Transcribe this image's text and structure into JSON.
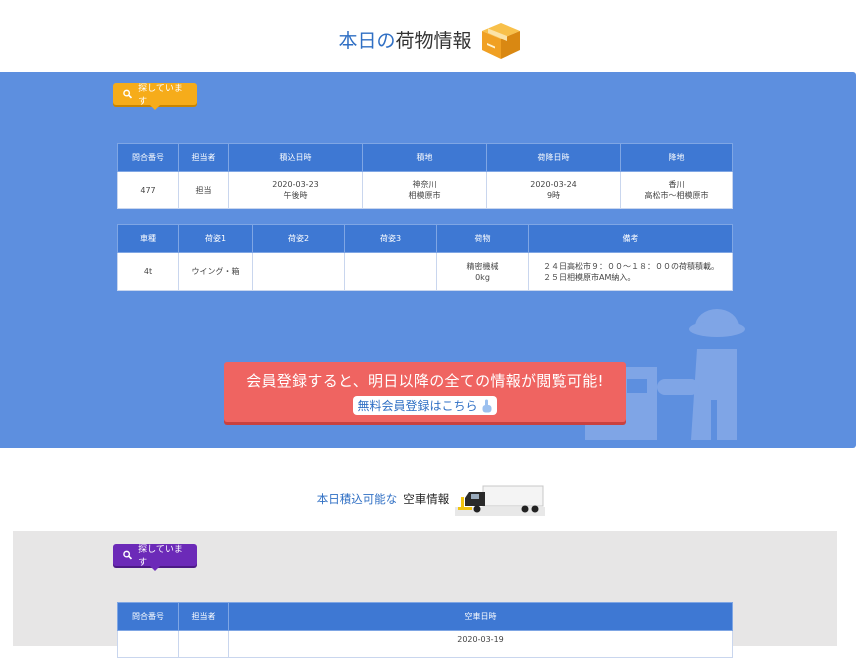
{
  "colors": {
    "accent_blue": "#5d8fdf",
    "header_blue": "#3e78d3",
    "cta_red": "#ef6461",
    "search_orange": "#f6ac1a",
    "search_purple": "#6c2ab8",
    "gray_panel": "#e7e6e6"
  },
  "cargo_section": {
    "title_part1": "本日の",
    "title_part2": "荷物情報",
    "box_icon": "cardboard-box-icon",
    "search_tab_label": "探しています",
    "table1": {
      "headers": [
        "問合番号",
        "担当者",
        "積込日時",
        "積地",
        "荷降日時",
        "降地"
      ],
      "row": {
        "inquiry_no": "477",
        "staff": "担当",
        "load_date": "2020-03-23",
        "load_time": "午後時",
        "load_place1": "神奈川",
        "load_place2": "相模原市",
        "unload_date": "2020-03-24",
        "unload_time": "9時",
        "unload_place1": "香川",
        "unload_place2": "高松市〜相模原市"
      }
    },
    "table2": {
      "headers": [
        "車種",
        "荷姿1",
        "荷姿2",
        "荷姿3",
        "荷物",
        "備考"
      ],
      "row": {
        "vehicle": "4t",
        "type1": "ウイング・箱",
        "type2": "",
        "type3": "",
        "cargo_name": "精密機械",
        "cargo_weight": "0kg",
        "note": "２４日高松市９：００〜１８：００の荷積積載。　２５日相模原市AM納入。"
      }
    },
    "cta_text": "会員登録すると、明日以降の全ての情報が閲覧可能!",
    "cta_button_label": "無料会員登録はこちら"
  },
  "truck_section": {
    "title_part1": "本日積込可能な",
    "title_part2": "空車情報",
    "truck_icon": "truck-icon",
    "search_tab_label": "探しています",
    "table": {
      "headers": [
        "問合番号",
        "担当者",
        "空車日時"
      ],
      "row": {
        "inquiry_no": "",
        "staff": "",
        "date": "2020-03-19"
      }
    }
  }
}
